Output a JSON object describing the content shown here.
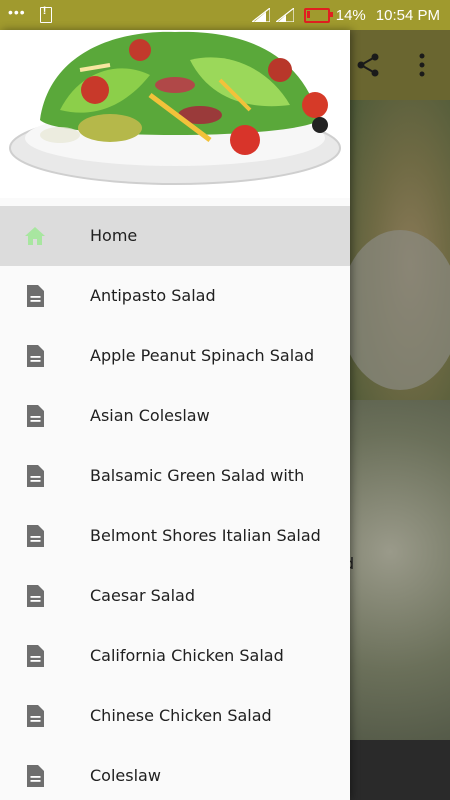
{
  "status_bar": {
    "battery_percent": "14%",
    "time": "10:54 PM",
    "icons": [
      "notification-dots-icon",
      "warning-icon",
      "signal-icon",
      "signal-icon",
      "battery-icon"
    ]
  },
  "background": {
    "partial_text": "d"
  },
  "drawer": {
    "items": [
      {
        "label": "Home",
        "icon": "home-icon",
        "active": true
      },
      {
        "label": "Antipasto Salad",
        "icon": "document-icon"
      },
      {
        "label": "Apple Peanut Spinach Salad",
        "icon": "document-icon"
      },
      {
        "label": "Asian Coleslaw",
        "icon": "document-icon"
      },
      {
        "label": "Balsamic Green Salad with",
        "icon": "document-icon"
      },
      {
        "label": "Belmont Shores Italian Salad",
        "icon": "document-icon"
      },
      {
        "label": "Caesar Salad",
        "icon": "document-icon"
      },
      {
        "label": "California Chicken Salad",
        "icon": "document-icon"
      },
      {
        "label": "Chinese Chicken Salad",
        "icon": "document-icon"
      },
      {
        "label": "Coleslaw",
        "icon": "document-icon"
      }
    ]
  },
  "colors": {
    "status_bar": "#a09a2e",
    "home_icon": "#a8e6a0",
    "document_icon": "#6e6e6e",
    "active_item_bg": "#dcdcdc"
  }
}
